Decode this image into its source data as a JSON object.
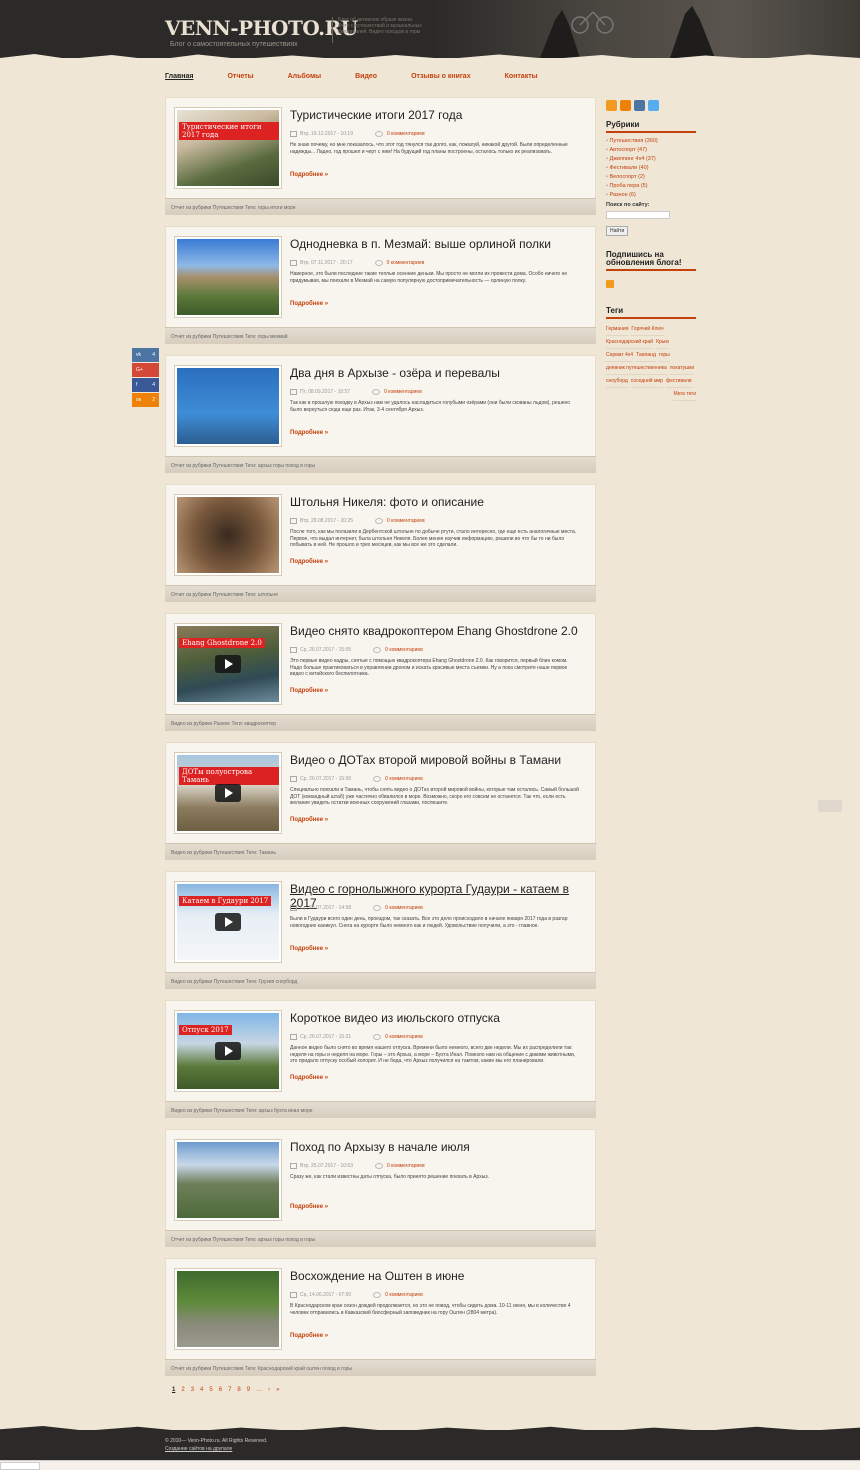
{
  "header": {
    "logo": "VENN-PHOTO.RU",
    "tagline": "Блог о самостоятельных путешествиях",
    "description": "Блог об активном образе жизни. Фото с путешествий и музыкальных фестивалей. Видео походов в горы"
  },
  "nav": [
    {
      "label": "Главная",
      "active": true
    },
    {
      "label": "Отчеты"
    },
    {
      "label": "Альбомы"
    },
    {
      "label": "Видео"
    },
    {
      "label": "Отзывы о книгах"
    },
    {
      "label": "Контакты"
    }
  ],
  "posts": [
    {
      "title": "Туристические итоги 2017 года",
      "date": "Втр, 19.12.2017 - 10:19",
      "comments": "0 комментариев",
      "excerpt": "Не знаю почему, но мне показалось, что этот год тянулся так долго, как, пожалуй, никакой другой. Были определенные надежды... Ладно, год прошел и черт с ним! На будущий год планы построены, осталось только их реализовать.",
      "more": "Подробнее »",
      "foot": "Отчет из рубрики Путешествия Теги: горы итоги море",
      "overlay": "Туристические итоги 2017 года"
    },
    {
      "title": "Однодневка в п. Мезмай: выше орлиной полки",
      "date": "Втр, 07.11.2017 - 20:17",
      "comments": "0 комментариев",
      "excerpt": "Наверное, это были последние такие теплые осенние деньки. Мы просто не могли их провести дома. Особо ничего не придумывая, мы поехали в Мезмай на самую популярную достопримечательность — орлиную полку.",
      "more": "Подробнее »",
      "foot": "Отчет из рубрики Путешествия Теги: горы мезмай"
    },
    {
      "title": "Два дня в Архызе - озёра и перевалы",
      "date": "Пт, 08.09.2017 - 10:57",
      "comments": "0 комментариев",
      "excerpt": "Так как в прошлую поездку в Архыз нам не удалось насладиться голубыми озёрами (они были скованы льдом), решено было вернуться сюда еще раз. Итак, 3-4 сентября Архыз.",
      "more": "Подробнее »",
      "foot": "Отчет из рубрики Путешествия Теги: архыз горы поход в горы"
    },
    {
      "title": "Штольня Никеля: фото и описание",
      "date": "Втр, 29.08.2017 - 20:25",
      "comments": "0 комментариев",
      "excerpt": "После того, как мы полазили в Дербентской штольне по добыче ртути, стало интересно, где еще есть аналогичные места. Первое, что выдал интернет, была штольня Никеля. Более менее изучив информацию, решили во что бы то ни было побывать в ней. Не прошло и трех месяцев, как мы все же это сделали.",
      "more": "Подробнее »",
      "foot": "Отчет из рубрики Путешествия Теги: штольня"
    },
    {
      "title": "Видео снято квадрокоптером Ehang Ghostdrone 2.0",
      "date": "Ср, 26.07.2017 - 15:05",
      "comments": "0 комментариев",
      "excerpt": "Это первые видео кадры, снятые с помощью квадрокоптера Ehang Ghostdrone 2.0. Как говорится, первый блин комом. Надо больше практиковаться в управлении дроном и искать красивые места съемки. Ну а пока смотрите наше первое видео с китайского беспилотника.",
      "more": "Подробнее »",
      "foot": "Видео из рубрики Разное Теги: квадрокоптер",
      "overlay": "Ehang Ghostdrone 2.0",
      "video": true
    },
    {
      "title": "Видео о ДОТах второй мировой войны в Тамани",
      "date": "Ср, 26.07.2017 - 15:00",
      "comments": "0 комментариев",
      "excerpt": "Специально поехали в Тамань, чтобы снять видео о ДОТах второй мировой войны, которые там остались. Самый большой ДОТ (командный штаб) уже частично обвалился в море. Возможно, скоро его совсем не останется. Так что, если есть желание увидеть остатки военных сооружений глазами, поспешите.",
      "more": "Подробнее »",
      "foot": "Видео из рубрики Путешествия Теги: Тамань",
      "overlay": "ДОТы полуострова Тамань",
      "video": true
    },
    {
      "title": "Видео с горнолыжного курорта Гудаури - катаем в 2017",
      "date": "Ср, 26.07.2017 - 14:58",
      "comments": "0 комментариев",
      "excerpt": "Были в Гудаури всего один день, проездом, так сказать. Все это дело происходило в начале января 2017 года в разгар новогодних каникул. Снега на курорте было немного как и людей. Удовольствие получили, а это - главное.",
      "more": "Подробнее »",
      "foot": "Видео из рубрики Путешествия Теги: Грузия сноуборд",
      "overlay": "Катаем в Гудаури 2017",
      "video": true
    },
    {
      "title": "Короткое видео из июльского отпуска",
      "date": "Ср, 26.07.2017 - 15:21",
      "comments": "0 комментариев",
      "excerpt": "Данное видео было снято во время нашего отпуска. Времени было немного, всего две недели. Мы их распределили так: неделя на горы и неделя на море. Горы – это Архыз, а море – Бухта Инал. Повезло нам на общение с дикими животными, это придало отпуску особый колорит. И не беда, что Архыз получился на тамтом, какие мы его планировали.",
      "more": "Подробнее »",
      "foot": "Видео из рубрики Путешествия Теги: архыз бухта инал море",
      "overlay": "Отпуск 2017",
      "video": true
    },
    {
      "title": "Поход по Архызу в начале июля",
      "date": "Втр, 25.07.2017 - 10:53",
      "comments": "0 комментариев",
      "excerpt": "Сразу же, как стали известны даты отпуска, было принято решение поехать в Архыз.",
      "more": "Подробнее »",
      "foot": "Отчет из рубрики Путешествия Теги: архыз горы поход в горы"
    },
    {
      "title": "Восхождение на Оштен в июне",
      "date": "Ср, 14.06.2017 - 07:50",
      "comments": "0 комментариев",
      "excerpt": "В Краснодарском крае сезон дождей продолжается, но это не повод, чтобы сидеть дома. 10-11 июня, мы в количестве 4 человек отправились в Кавказский биосферный заповедник на гору Оштен (2804 метра).",
      "more": "Подробнее »",
      "foot": "Отчет из рубрики Путешествия Теги: Краснодарский край оштен поход в горы"
    }
  ],
  "sidebar": {
    "rubrics_title": "Рубрики",
    "rubrics": [
      "Путешествия (360)",
      "Автоспорт (47)",
      "Джиппинг 4х4 (37)",
      "Фестивали (40)",
      "Велоспорт (2)",
      "Проба пера (5)",
      "Разное (6)"
    ],
    "search_label": "Поиск по сайту:",
    "search_button": "Найти",
    "subscribe_title": "Подпишись на обновления блога!",
    "tags_title": "Теги",
    "tags": [
      "Германия",
      "Горячий Ключ",
      "Краснодарский край",
      "Крым",
      "Сармат 4х4",
      "Таиланд",
      "горы",
      "дневник путешественника",
      "покатушки",
      "сноуборд",
      "соседний мир",
      "фестивали",
      "Мега теги"
    ]
  },
  "share": [
    {
      "n": "vk",
      "c": "4",
      "color": "#4c75a3"
    },
    {
      "n": "g+",
      "c": "",
      "color": "#d34836"
    },
    {
      "n": "f",
      "c": "4",
      "color": "#3b5998"
    },
    {
      "n": "ok",
      "c": "2",
      "color": "#ee8208"
    }
  ],
  "pager": [
    "1",
    "2",
    "3",
    "4",
    "5",
    "6",
    "7",
    "8",
    "9",
    "…",
    "›",
    "»"
  ],
  "footer": {
    "copy": "© 2010— Venn-Photo.ru. All Rights Reserved.",
    "link": "Создание сайтов на друпале"
  }
}
